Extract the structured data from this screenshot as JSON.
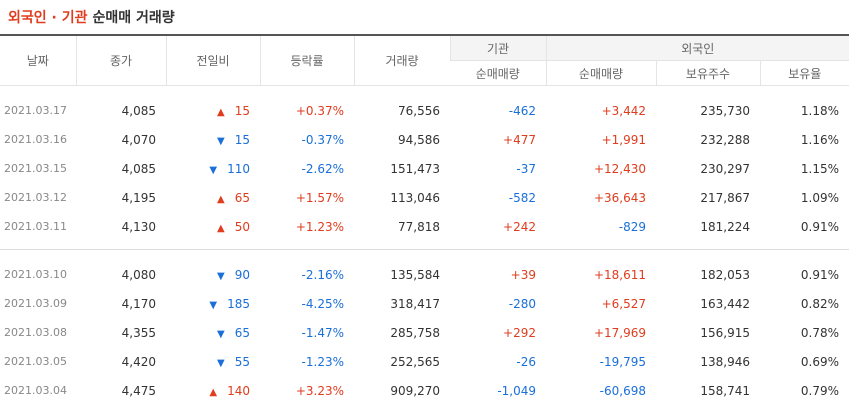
{
  "title": {
    "part1": "외국인 · 기관",
    "part2": "순매매 거래량"
  },
  "headers": {
    "date": "날짜",
    "close": "종가",
    "change": "전일비",
    "rate": "등락률",
    "volume": "거래량",
    "inst_group": "기관",
    "inst_net": "순매매량",
    "foreign_group": "외국인",
    "foreign_net": "순매매량",
    "foreign_holdings": "보유주수",
    "foreign_ratio": "보유율"
  },
  "icons": {
    "up": "up-triangle-icon",
    "down": "down-triangle-icon"
  },
  "colors": {
    "up": "#e03c1e",
    "down": "#1a6fd8"
  },
  "rows": [
    {
      "date": "2021.03.17",
      "close": "4,085",
      "dir": "up",
      "arrow": "▲",
      "change": "15",
      "rate": "+0.37%",
      "volume": "76,556",
      "inst": "-462",
      "inst_dir": "down",
      "foreign": "+3,442",
      "foreign_dir": "up",
      "holdings": "235,730",
      "ratio": "1.18%"
    },
    {
      "date": "2021.03.16",
      "close": "4,070",
      "dir": "down",
      "arrow": "▼",
      "change": "15",
      "rate": "-0.37%",
      "volume": "94,586",
      "inst": "+477",
      "inst_dir": "up",
      "foreign": "+1,991",
      "foreign_dir": "up",
      "holdings": "232,288",
      "ratio": "1.16%"
    },
    {
      "date": "2021.03.15",
      "close": "4,085",
      "dir": "down",
      "arrow": "▼",
      "change": "110",
      "rate": "-2.62%",
      "volume": "151,473",
      "inst": "-37",
      "inst_dir": "down",
      "foreign": "+12,430",
      "foreign_dir": "up",
      "holdings": "230,297",
      "ratio": "1.15%"
    },
    {
      "date": "2021.03.12",
      "close": "4,195",
      "dir": "up",
      "arrow": "▲",
      "change": "65",
      "rate": "+1.57%",
      "volume": "113,046",
      "inst": "-582",
      "inst_dir": "down",
      "foreign": "+36,643",
      "foreign_dir": "up",
      "holdings": "217,867",
      "ratio": "1.09%"
    },
    {
      "date": "2021.03.11",
      "close": "4,130",
      "dir": "up",
      "arrow": "▲",
      "change": "50",
      "rate": "+1.23%",
      "volume": "77,818",
      "inst": "+242",
      "inst_dir": "up",
      "foreign": "-829",
      "foreign_dir": "down",
      "holdings": "181,224",
      "ratio": "0.91%"
    },
    {
      "date": "2021.03.10",
      "close": "4,080",
      "dir": "down",
      "arrow": "▼",
      "change": "90",
      "rate": "-2.16%",
      "volume": "135,584",
      "inst": "+39",
      "inst_dir": "up",
      "foreign": "+18,611",
      "foreign_dir": "up",
      "holdings": "182,053",
      "ratio": "0.91%"
    },
    {
      "date": "2021.03.09",
      "close": "4,170",
      "dir": "down",
      "arrow": "▼",
      "change": "185",
      "rate": "-4.25%",
      "volume": "318,417",
      "inst": "-280",
      "inst_dir": "down",
      "foreign": "+6,527",
      "foreign_dir": "up",
      "holdings": "163,442",
      "ratio": "0.82%"
    },
    {
      "date": "2021.03.08",
      "close": "4,355",
      "dir": "down",
      "arrow": "▼",
      "change": "65",
      "rate": "-1.47%",
      "volume": "285,758",
      "inst": "+292",
      "inst_dir": "up",
      "foreign": "+17,969",
      "foreign_dir": "up",
      "holdings": "156,915",
      "ratio": "0.78%"
    },
    {
      "date": "2021.03.05",
      "close": "4,420",
      "dir": "down",
      "arrow": "▼",
      "change": "55",
      "rate": "-1.23%",
      "volume": "252,565",
      "inst": "-26",
      "inst_dir": "down",
      "foreign": "-19,795",
      "foreign_dir": "down",
      "holdings": "138,946",
      "ratio": "0.69%"
    },
    {
      "date": "2021.03.04",
      "close": "4,475",
      "dir": "up",
      "arrow": "▲",
      "change": "140",
      "rate": "+3.23%",
      "volume": "909,270",
      "inst": "-1,049",
      "inst_dir": "down",
      "foreign": "-60,698",
      "foreign_dir": "down",
      "holdings": "158,741",
      "ratio": "0.79%"
    }
  ]
}
